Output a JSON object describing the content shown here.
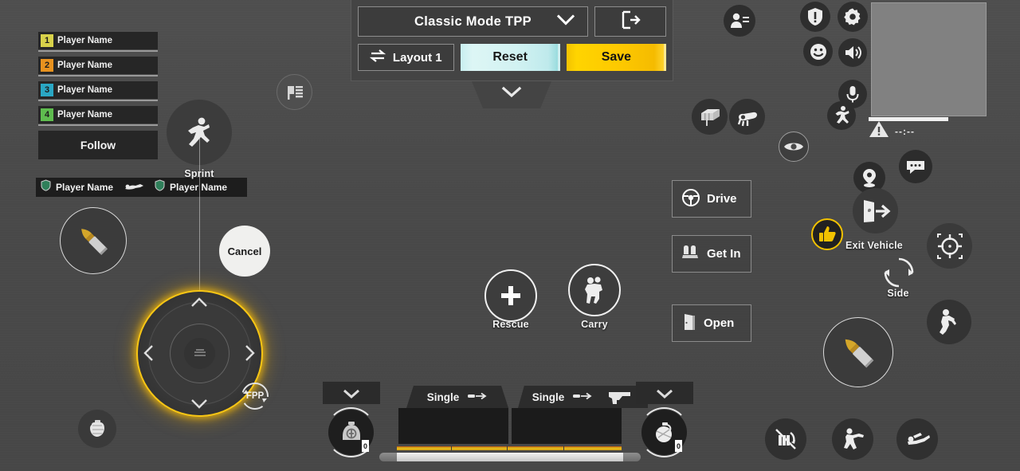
{
  "topbar": {
    "mode_label": "Classic Mode TPP",
    "mode_chevron_icon": "chevron-down-icon",
    "exit_icon": "exit-icon",
    "layout_label": "Layout 1",
    "layout_icon": "swap-icon",
    "reset_label": "Reset",
    "save_label": "Save",
    "collapse_icon": "chevron-down-icon",
    "colors": {
      "reset": "#cdf0f1",
      "save": "#fdc800",
      "panel": "#444444",
      "border": "#8d8d8d"
    }
  },
  "team_panel": {
    "players": [
      {
        "num": "1",
        "name": "Player Name",
        "color": "#d8d24a"
      },
      {
        "num": "2",
        "name": "Player Name",
        "color": "#e8921f"
      },
      {
        "num": "3",
        "name": "Player Name",
        "color": "#2aa7c4"
      },
      {
        "num": "4",
        "name": "Player Name",
        "color": "#5fbd4f"
      }
    ],
    "follow_label": "Follow"
  },
  "killfeed": {
    "left_name": "Player Name",
    "right_name": "Player Name",
    "weapon_icon": "prone-kill-icon",
    "badge_icon": "shield-icon"
  },
  "controls": {
    "sprint": {
      "label": "Sprint",
      "icon": "sprint-run-icon"
    },
    "cancel": {
      "label": "Cancel"
    },
    "fpp": {
      "label": "FPP",
      "icon": "camera-rotate-icon"
    },
    "rescue": {
      "label": "Rescue",
      "icon": "plus-icon"
    },
    "carry": {
      "label": "Carry",
      "icon": "carry-person-icon"
    },
    "exit_vehicle": {
      "label": "Exit Vehicle",
      "icon": "exit-vehicle-icon"
    },
    "side": {
      "label": "Side",
      "icon": "rotate-arrows-icon"
    },
    "joystick": {
      "icon": "movement-joystick",
      "state": "selected",
      "highlight_color": "#fac814"
    },
    "left_fire": {
      "icon": "bullet-icon"
    },
    "right_fire": {
      "icon": "bullet-icon"
    },
    "grenade_left": {
      "icon": "grenade-icon"
    },
    "menu_flag": {
      "icon": "flag-list-icon"
    },
    "peek": {
      "icon": "eye-peek-icon"
    }
  },
  "rect_buttons": [
    {
      "label": "Drive",
      "icon": "steering-wheel-icon"
    },
    {
      "label": "Get In",
      "icon": "car-seat-icon"
    },
    {
      "label": "Open",
      "icon": "door-icon"
    }
  ],
  "weapon_slots": [
    {
      "fire_mode": "Single",
      "mode_icon": "bullet-arrow-icon"
    },
    {
      "fire_mode": "Single",
      "mode_icon": "bullet-arrow-icon",
      "extra_icon": "pistol-icon"
    }
  ],
  "item_slots": [
    {
      "icon": "helmet-icon",
      "count": "0",
      "chevron_icon": "chevron-down-icon"
    },
    {
      "icon": "grenade-icon",
      "count": "0",
      "chevron_icon": "chevron-down-icon"
    }
  ],
  "top_right_icons": [
    {
      "name": "team-invite-icon"
    },
    {
      "name": "alert-shield-icon"
    },
    {
      "name": "settings-gear-icon"
    },
    {
      "name": "emoji-icon"
    },
    {
      "name": "speaker-icon"
    },
    {
      "name": "microphone-icon"
    },
    {
      "name": "sprint-toggle-icon"
    },
    {
      "name": "crate-icon"
    },
    {
      "name": "pickup-hand-icon"
    },
    {
      "name": "map-pin-icon"
    },
    {
      "name": "chat-bubble-icon"
    }
  ],
  "stance_icons": [
    {
      "name": "scope-crosshair-icon"
    },
    {
      "name": "jump-icon"
    },
    {
      "name": "reload-icon"
    },
    {
      "name": "crouch-icon"
    },
    {
      "name": "prone-icon"
    }
  ],
  "minimap": {
    "warning_icon": "warning-triangle-icon",
    "warning_text": "--:--"
  }
}
